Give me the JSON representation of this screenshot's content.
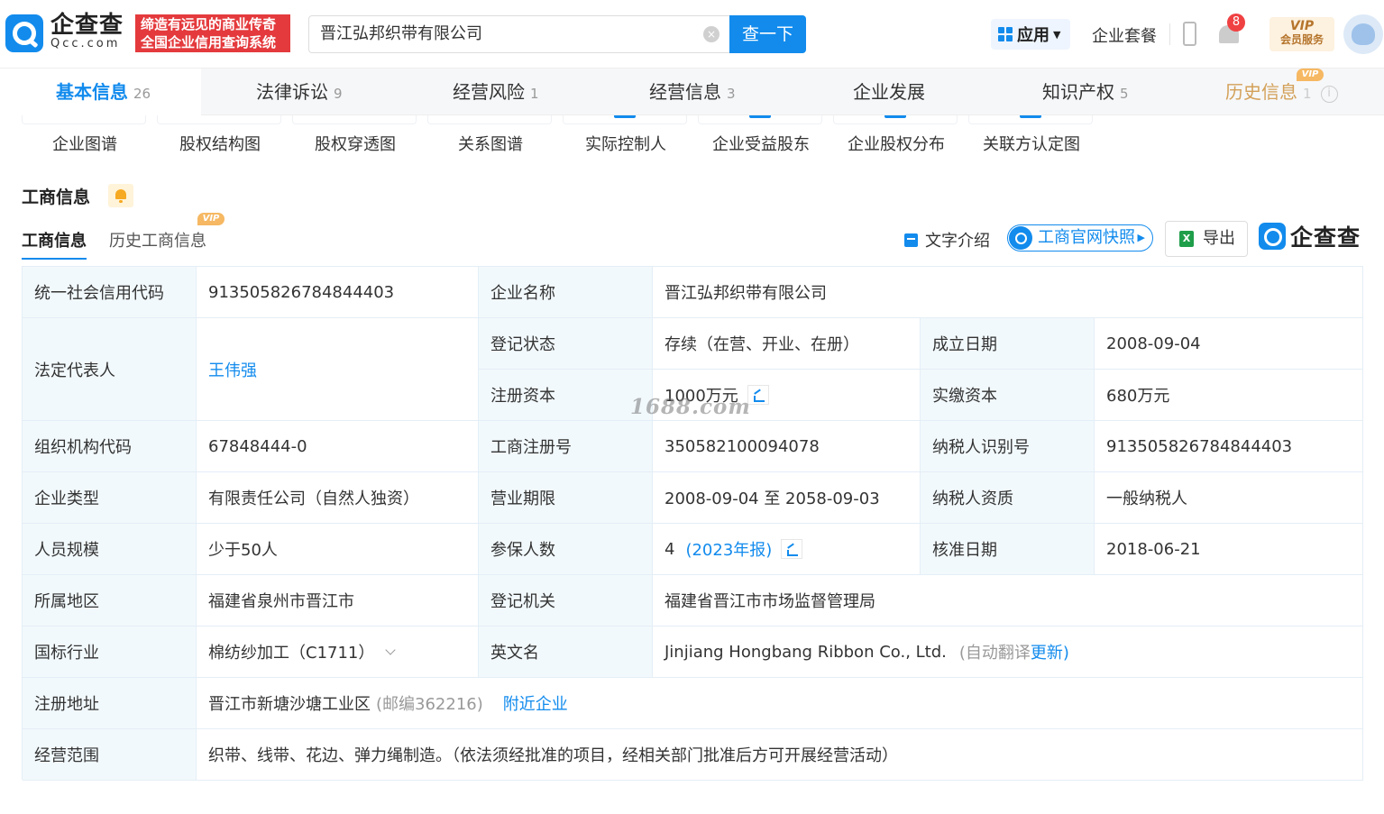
{
  "header": {
    "brand_cn": "企查查",
    "brand_en": "Qcc.com",
    "slogan_line1": "缔造有远见的商业传奇",
    "slogan_line2": "全国企业信用查询系统",
    "search_value": "晋江弘邦织带有限公司",
    "search_button": "查一下",
    "apps_label": "应用",
    "package_label": "企业套餐",
    "notification_count": "8",
    "vip_label": "VIP",
    "vip_sub": "会员服务"
  },
  "tabs": [
    {
      "label": "基本信息",
      "count": "26"
    },
    {
      "label": "法律诉讼",
      "count": "9"
    },
    {
      "label": "经营风险",
      "count": "1"
    },
    {
      "label": "经营信息",
      "count": "3"
    },
    {
      "label": "企业发展",
      "count": ""
    },
    {
      "label": "知识产权",
      "count": "5"
    },
    {
      "label": "历史信息",
      "count": "1"
    }
  ],
  "tab_vip_tag": "VIP",
  "shortcuts": [
    "企业图谱",
    "股权结构图",
    "股权穿透图",
    "关系图谱",
    "实际控制人",
    "企业受益股东",
    "企业股权分布",
    "关联方认定图"
  ],
  "section": {
    "title": "工商信息",
    "subtab_active": "工商信息",
    "subtab_history": "历史工商信息",
    "subtab_vip": "VIP",
    "intro": "文字介绍",
    "snapshot": "工商官网快照",
    "export": "导出",
    "export_icon": "X",
    "qcc_mark": "企查查"
  },
  "info": {
    "credit_code_label": "统一社会信用代码",
    "credit_code": "913505826784844403",
    "name_label": "企业名称",
    "name": "晋江弘邦织带有限公司",
    "legal_rep_label": "法定代表人",
    "legal_rep": "王伟强",
    "status_label": "登记状态",
    "status": "存续（在营、开业、在册）",
    "established_label": "成立日期",
    "established": "2008-09-04",
    "reg_capital_label": "注册资本",
    "reg_capital": "1000万元",
    "paid_capital_label": "实缴资本",
    "paid_capital": "680万元",
    "org_code_label": "组织机构代码",
    "org_code": "67848444-0",
    "reg_no_label": "工商注册号",
    "reg_no": "350582100094078",
    "taxpayer_id_label": "纳税人识别号",
    "taxpayer_id": "913505826784844403",
    "type_label": "企业类型",
    "type": "有限责任公司（自然人独资）",
    "term_label": "营业期限",
    "term": "2008-09-04 至 2058-09-03",
    "taxpayer_qual_label": "纳税人资质",
    "taxpayer_qual": "一般纳税人",
    "staff_label": "人员规模",
    "staff": "少于50人",
    "insured_label": "参保人数",
    "insured": "4",
    "insured_report": "(2023年报)",
    "approved_label": "核准日期",
    "approved": "2018-06-21",
    "region_label": "所属地区",
    "region": "福建省泉州市晋江市",
    "authority_label": "登记机关",
    "authority": "福建省晋江市市场监督管理局",
    "industry_label": "国标行业",
    "industry": "棉纺纱加工（C1711）",
    "english_label": "英文名",
    "english": "Jinjiang Hongbang Ribbon Co., Ltd.",
    "english_note": "(自动翻译",
    "english_update": "更新)",
    "address_label": "注册地址",
    "address": "晋江市新塘沙塘工业区",
    "postcode": "(邮编362216)",
    "nearby": "附近企业",
    "scope_label": "经营范围",
    "scope": "织带、线带、花边、弹力绳制造。（依法须经批准的项目，经相关部门批准后方可开展经营活动）"
  },
  "watermark": "1688.com"
}
